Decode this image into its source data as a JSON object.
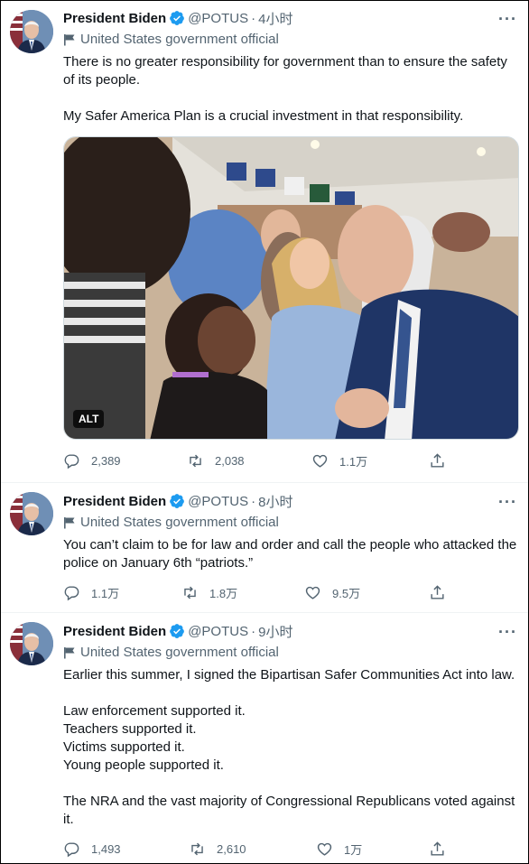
{
  "colors": {
    "accent": "#1d9bf0",
    "text": "#0f1419",
    "muted": "#536471",
    "divider": "#eff3f4"
  },
  "tweets": [
    {
      "name": "President Biden",
      "handle": "@POTUS",
      "sep": "·",
      "time": "4小时",
      "label": "United States government official",
      "paragraphs": [
        "There is no greater responsibility for government than to ensure the safety of its people.",
        "My Safer America Plan is a crucial investment in that responsibility."
      ],
      "media_alt": "ALT",
      "replies": "2,389",
      "retweets": "2,038",
      "likes": "1.1万"
    },
    {
      "name": "President Biden",
      "handle": "@POTUS",
      "sep": "·",
      "time": "8小时",
      "label": "United States government official",
      "paragraphs": [
        "You can’t claim to be for law and order and call the people who attacked the police on January 6th “patriots.”"
      ],
      "replies": "1.1万",
      "retweets": "1.8万",
      "likes": "9.5万"
    },
    {
      "name": "President Biden",
      "handle": "@POTUS",
      "sep": "·",
      "time": "9小时",
      "label": "United States government official",
      "paragraphs": [
        "Earlier this summer, I signed the Bipartisan Safer Communities Act into law.",
        "Law enforcement supported it.\nTeachers supported it.\nVictims supported it.\nYoung people supported it.",
        "The NRA and the vast majority of Congressional Republicans voted against it."
      ],
      "replies": "1,493",
      "retweets": "2,610",
      "likes": "1万"
    }
  ],
  "icons": {
    "avatar": "avatar-portrait",
    "verified": "verified-badge-icon",
    "more": "more-icon",
    "label": "flag-icon",
    "reply": "reply-icon",
    "retweet": "retweet-icon",
    "like": "heart-icon",
    "share": "share-icon"
  }
}
